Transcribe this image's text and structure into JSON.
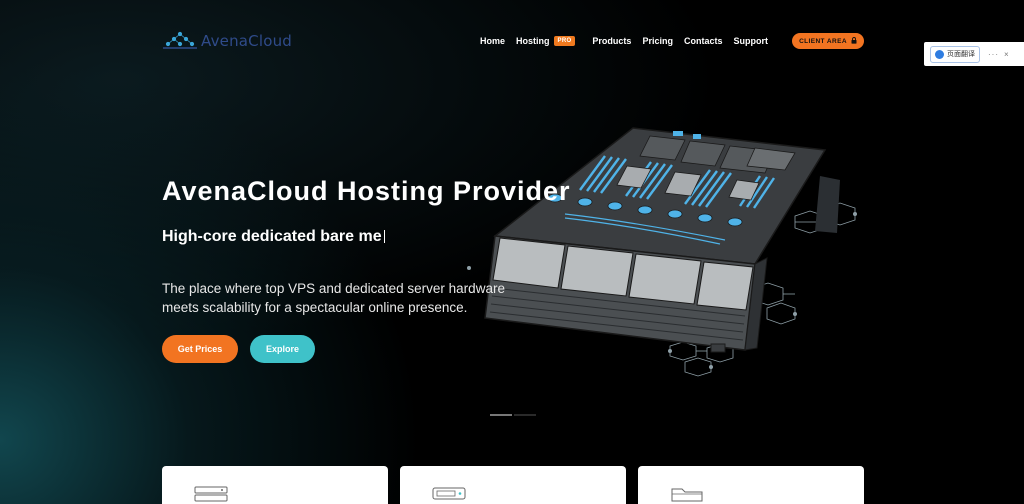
{
  "brand": {
    "name": "AvenaCloud",
    "logo_color": "#2f4b8a"
  },
  "nav": {
    "items": [
      {
        "label": "Home"
      },
      {
        "label": "Hosting",
        "badge": "PRO"
      },
      {
        "label": "Products"
      },
      {
        "label": "Pricing"
      },
      {
        "label": "Contacts"
      },
      {
        "label": "Support"
      }
    ],
    "client_area": "CLIENT AREA",
    "client_area_icon": "lock-icon"
  },
  "translate_widget": {
    "button_label": "页面翻译",
    "more": "···",
    "close": "×"
  },
  "hero": {
    "title": "AvenaCloud Hosting Provider",
    "subtitle": "High-core dedicated bare me",
    "description": "The place where top VPS and dedicated server hardware meets scalability for a spectacular online presence.",
    "primary_button": "Get Prices",
    "secondary_button": "Explore"
  },
  "cards": [
    {
      "icon": "server-icon"
    },
    {
      "icon": "hardware-icon"
    },
    {
      "icon": "folder-icon"
    }
  ],
  "colors": {
    "accent_orange": "#f27421",
    "accent_teal": "#3fc2c9",
    "server_blue": "#4fb3e8"
  }
}
